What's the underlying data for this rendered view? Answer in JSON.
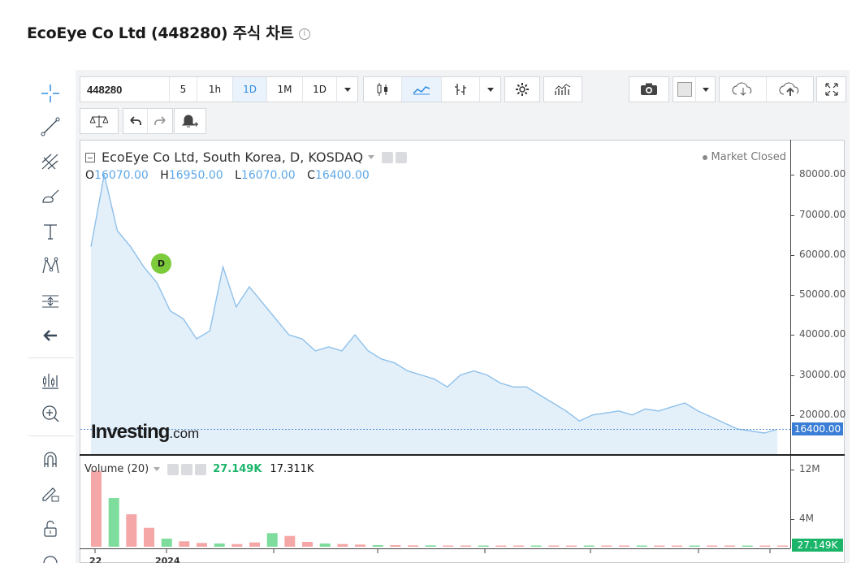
{
  "page": {
    "title": "EcoEye Co Ltd (448280) 주식 차트",
    "info_icon": "i"
  },
  "toolbar": {
    "symbol": "448280",
    "intervals": [
      "5",
      "1h",
      "1D",
      "1M",
      "1D"
    ],
    "active_interval": "1D"
  },
  "legend": {
    "title": "EcoEye Co Ltd, South Korea, D, KOSDAQ",
    "market_status": "Market Closed",
    "ohlc": {
      "o_label": "O",
      "o": "16070.00",
      "h_label": "H",
      "h": "16950.00",
      "l_label": "L",
      "l": "16070.00",
      "c_label": "C",
      "c": "16400.00"
    }
  },
  "watermark": {
    "brand": "Investing",
    "suffix": ".com"
  },
  "marker": {
    "label": "D"
  },
  "price_axis": {
    "ticks": [
      "80000.00",
      "70000.00",
      "60000.00",
      "50000.00",
      "40000.00",
      "30000.00",
      "20000.00"
    ],
    "last_price": "16400.00"
  },
  "volume": {
    "title": "Volume (20)",
    "value1": "27.149K",
    "value2": "17.311K",
    "ticks": [
      "12M",
      "4M"
    ],
    "last_value": "27.149K"
  },
  "x_axis": {
    "ticks": [
      "22",
      "2024"
    ]
  },
  "colors": {
    "line": "#8ec0ea",
    "area": "#e3f0fa",
    "accent": "#2f8de4",
    "vol_up": "#7edc9c",
    "vol_down": "#f5a7a7"
  },
  "chart_data": {
    "type": "area",
    "title": "EcoEye Co Ltd, South Korea, D, KOSDAQ",
    "ylim": [
      12000,
      85000
    ],
    "x": [
      "22",
      "2024"
    ],
    "series": [
      {
        "values": [
          62000,
          80000,
          66000,
          62000,
          57000,
          53000,
          46000,
          44000,
          39000,
          41000,
          57000,
          47000,
          52000,
          48000,
          44000,
          40000,
          39000,
          36000,
          37000,
          36000,
          40000,
          36000,
          34000,
          33000,
          31000,
          30000,
          29000,
          27000,
          30000,
          31000,
          30000,
          28000,
          27000,
          27000,
          25000,
          23000,
          21000,
          18500,
          20000,
          20500,
          21000,
          20000,
          21500,
          21000,
          22000,
          23000,
          21000,
          19500,
          18000,
          16500,
          16000,
          15500,
          16400
        ]
      }
    ],
    "volume": {
      "ylim": [
        0,
        15000000
      ],
      "values": [
        14000000,
        9000000,
        6000000,
        3500000,
        1500000,
        1000000,
        700000,
        600000,
        500000,
        800000,
        2500000,
        2000000,
        900000,
        600000,
        500000,
        400000,
        300000,
        300000,
        250000,
        250000,
        200000,
        200000,
        180000,
        180000,
        150000,
        150000,
        150000,
        150000,
        150000,
        150000,
        150000,
        150000,
        150000,
        150000,
        150000,
        150000,
        150000,
        150000,
        150000,
        150000
      ]
    }
  }
}
